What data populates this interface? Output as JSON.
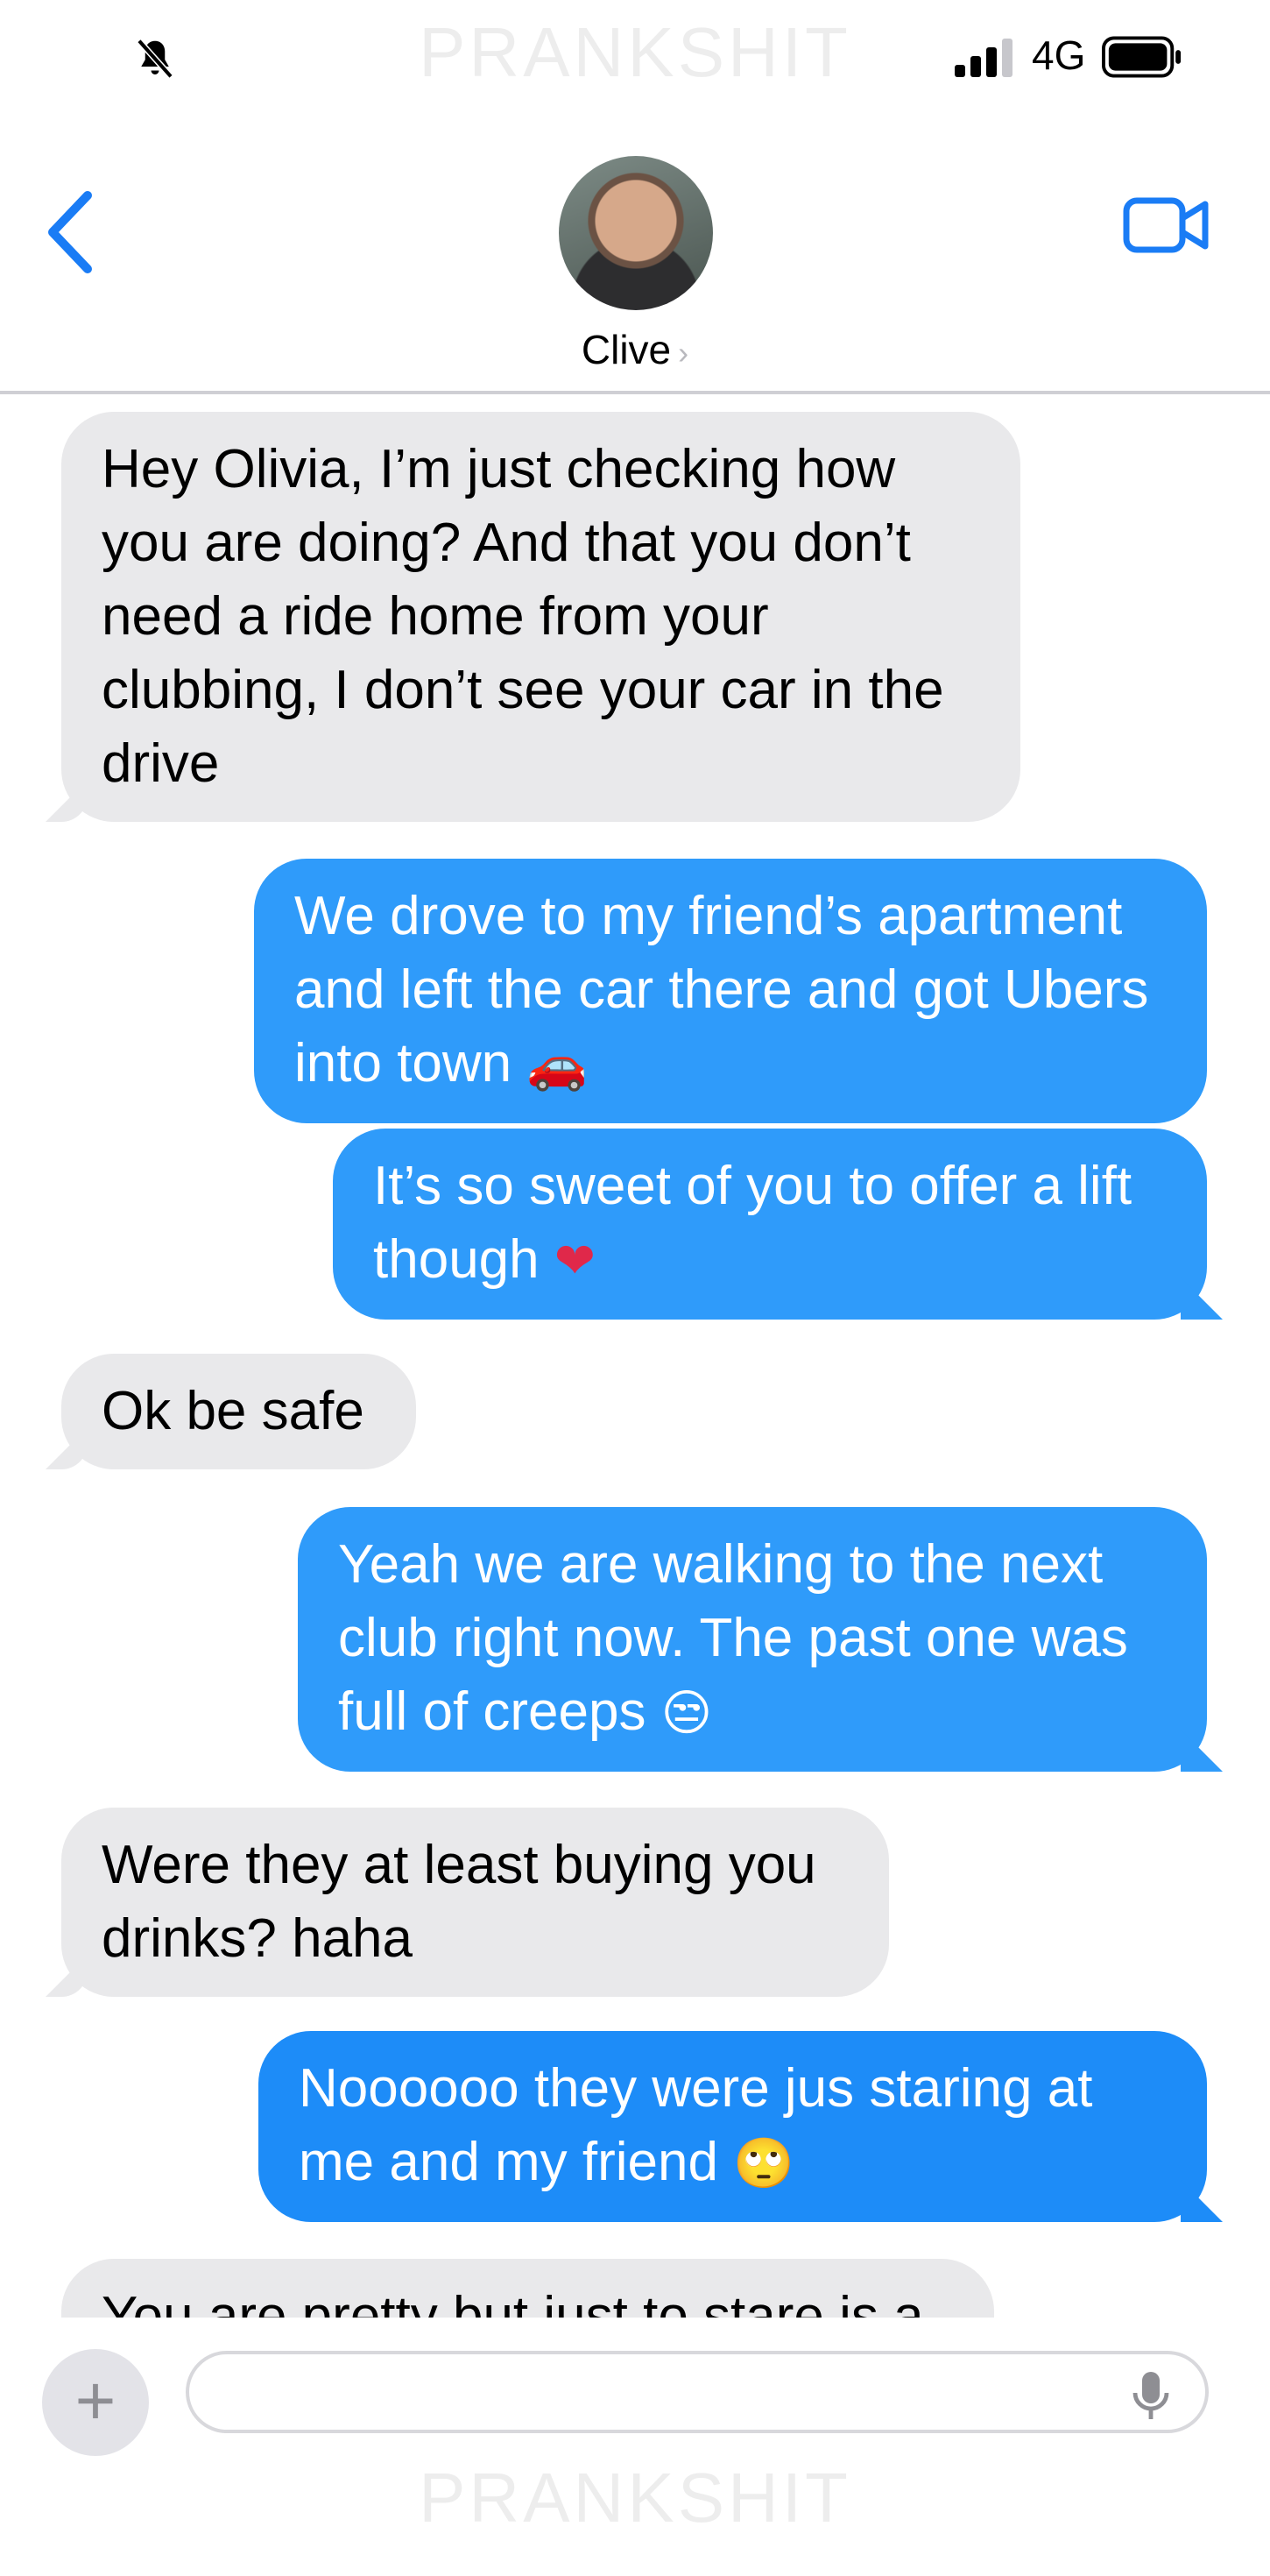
{
  "status_bar": {
    "network": "4G"
  },
  "watermark": "PRANKSHIT",
  "header": {
    "contact_name": "Clive",
    "chevron": "›"
  },
  "messages": [
    {
      "from": "them",
      "text": "Hey Olivia, I’m just checking how you are doing? And that you don’t need a ride home from your clubbing, I don’t see your car in the drive"
    },
    {
      "from": "me",
      "text": "We drove to my friend’s apartment and left the car there and got Ubers into town",
      "emoji": "🚗"
    },
    {
      "from": "me",
      "text": "It’s so sweet of you to offer a lift though",
      "emoji": "❤"
    },
    {
      "from": "them",
      "text": "Ok be safe"
    },
    {
      "from": "me",
      "text": "Yeah we are walking to the next club right now. The past one was full of creeps",
      "emoji": "😒"
    },
    {
      "from": "them",
      "text": "Were they at least buying you drinks? haha"
    },
    {
      "from": "me",
      "text": "Noooooo they were jus staring at me and my friend",
      "emoji": "🙄"
    },
    {
      "from": "them",
      "text": "You are pretty but just to stare is a"
    }
  ],
  "input": {
    "plus": "+",
    "placeholder": ""
  },
  "colors": {
    "accent": "#1a7cf5",
    "outgoing_bubble": "#2f9bfa",
    "incoming_bubble": "#e9e9eb"
  },
  "icons": [
    "bell-slash-icon",
    "signal-icon",
    "battery-icon",
    "back-chevron-icon",
    "video-camera-icon",
    "plus-icon",
    "microphone-icon"
  ]
}
